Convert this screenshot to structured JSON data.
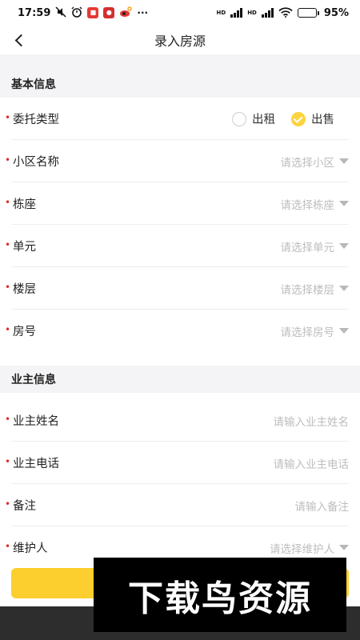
{
  "status_bar": {
    "time": "17:59",
    "battery_text": "95%",
    "battery_level": 0.95,
    "network_label_1": "HD",
    "network_label_2": "HD"
  },
  "nav": {
    "title": "录入房源"
  },
  "sections": {
    "basic_info": "基本信息",
    "owner_info": "业主信息"
  },
  "form": {
    "entrust_type": {
      "label": "委托类型",
      "options": [
        "出租",
        "出售"
      ],
      "selected": "出售"
    },
    "community": {
      "label": "小区名称",
      "placeholder": "请选择小区"
    },
    "building": {
      "label": "栋座",
      "placeholder": "请选择栋座"
    },
    "unit": {
      "label": "单元",
      "placeholder": "请选择单元"
    },
    "floor": {
      "label": "楼层",
      "placeholder": "请选择楼层"
    },
    "room": {
      "label": "房号",
      "placeholder": "请选择房号"
    },
    "owner_name": {
      "label": "业主姓名",
      "placeholder": "请输入业主姓名"
    },
    "owner_phone": {
      "label": "业主电话",
      "placeholder": "请输入业主电话"
    },
    "remark": {
      "label": "备注",
      "placeholder": "请输入备注"
    },
    "maintainer": {
      "label": "维护人",
      "placeholder": "请选择维护人"
    }
  },
  "watermark": {
    "text": "下载鸟资源"
  },
  "colors": {
    "accent": "#fdcf2e",
    "required": "#d9302c",
    "placeholder": "#bdbdbd",
    "section_bg": "#f4f4f6"
  },
  "icons": [
    "back-arrow-icon",
    "caret-down-icon",
    "check-icon",
    "wifi-icon",
    "battery-icon",
    "alarm-icon"
  ]
}
